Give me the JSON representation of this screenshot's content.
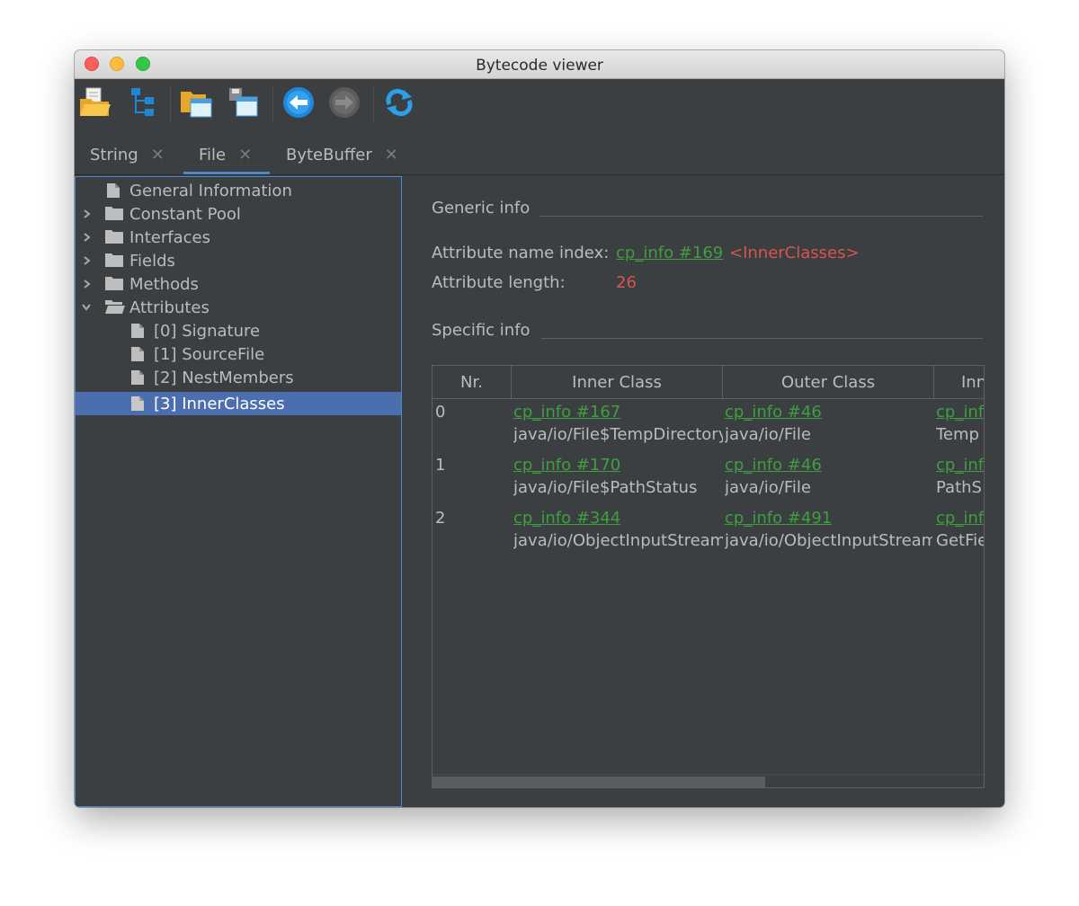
{
  "window": {
    "title": "Bytecode viewer"
  },
  "toolbar": {
    "buttons": [
      {
        "icon": "open-folder-icon"
      },
      {
        "icon": "hierarchy-icon"
      },
      {
        "icon": "open-window-folder-icon"
      },
      {
        "icon": "save-window-icon"
      },
      {
        "icon": "back-arrow-icon"
      },
      {
        "icon": "forward-arrow-icon"
      },
      {
        "icon": "refresh-icon"
      }
    ]
  },
  "tabs": [
    {
      "label": "String",
      "close": "✕"
    },
    {
      "label": "File",
      "close": "✕",
      "active": true
    },
    {
      "label": "ByteBuffer",
      "close": "✕"
    }
  ],
  "tree": {
    "items": [
      {
        "label": "General Information"
      },
      {
        "label": "Constant Pool"
      },
      {
        "label": "Interfaces"
      },
      {
        "label": "Fields"
      },
      {
        "label": "Methods"
      },
      {
        "label": "Attributes"
      },
      {
        "label": "[0] Signature"
      },
      {
        "label": "[1] SourceFile"
      },
      {
        "label": "[2] NestMembers"
      },
      {
        "label": "[3] InnerClasses",
        "selected": true
      }
    ]
  },
  "generic": {
    "heading": "Generic info",
    "name_index_label": "Attribute name index:",
    "name_index_link": "cp_info #169",
    "name_index_value": "<InnerClasses>",
    "length_label": "Attribute length:",
    "length_value": "26"
  },
  "specific": {
    "heading": "Specific info"
  },
  "table": {
    "headers": [
      "Nr.",
      "Inner Class",
      "Outer Class",
      "Inn"
    ],
    "rows": [
      {
        "nr": "0",
        "inner_link": "cp_info #167",
        "inner_name": "java/io/File$TempDirectory",
        "outer_link": "cp_info #46",
        "outer_name": "java/io/File",
        "name_link": "cp_info",
        "name_value": "Temp"
      },
      {
        "nr": "1",
        "inner_link": "cp_info #170",
        "inner_name": "java/io/File$PathStatus",
        "outer_link": "cp_info #46",
        "outer_name": "java/io/File",
        "name_link": "cp_info",
        "name_value": "PathS"
      },
      {
        "nr": "2",
        "inner_link": "cp_info #344",
        "inner_name": "java/io/ObjectInputStream",
        "outer_link": "cp_info #491",
        "outer_name": "java/io/ObjectInputStream",
        "name_link": "cp_info",
        "name_value": "GetFie"
      }
    ]
  },
  "colors": {
    "link": "#3f9f3f",
    "highlight": "#d9534f",
    "selection": "#4b6eaf",
    "accent": "#4a88c7"
  }
}
